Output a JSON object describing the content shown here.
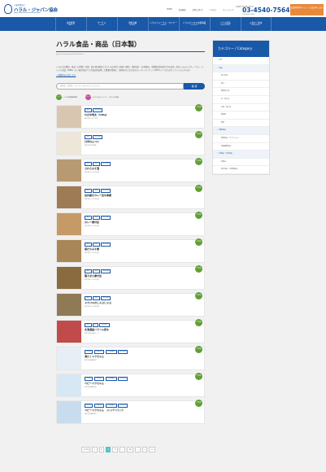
{
  "header": {
    "logo_small": "一般社団法人",
    "logo_text": "ハラル・ジャパン協会",
    "logo_en": "Japan Halal Business Association",
    "toplinks": [
      "HOME",
      "協会概要",
      "お問い合わせ",
      "アクセス",
      "サイトマップ"
    ],
    "tel_label": "お電話でのお問い合わせ",
    "tel": "03-4540-7564",
    "tel_hours": "平日 10:00〜18:00",
    "member_button": "会員様専用ページ／入会お申し込み"
  },
  "nav": [
    {
      "jp": "協会概要",
      "en": "About"
    },
    {
      "jp": "サービス",
      "en": "Service"
    },
    {
      "jp": "活動実績",
      "en": "Activity"
    },
    {
      "jp": "ハラルフォーラム・セミナー",
      "en": "Seminar"
    },
    {
      "jp": "ハラルビジネス支援事業",
      "en": "Business"
    },
    {
      "jp": "ハラル商品",
      "en": "Halal Products"
    },
    {
      "jp": "入会のご案内",
      "en": "Membership"
    }
  ],
  "page": {
    "title": "ハラル食品・商品（日本製）",
    "subtitle": "Japan International Halal Products",
    "intro": "こちらでは食品・商品（日本製）企業・個人様の販売されている日本から海外へ販売・提供会社・日本製品・企業製品等を紹介中の自社一覧のシステムです。ハラル・ジャパン協会（HJBA）の一般社団法人です認証を取得して数量や情報と、国内外のさまざまのスーパーマーケットやECサイトなどのオンラインビジネスの…",
    "intro_link": "→ 掲載申込みはこちら"
  },
  "search": {
    "placeholder": "商品名、会社名、キーワードを入力してください。",
    "button": "検 索"
  },
  "legend": [
    {
      "mark": "ハラル",
      "label": "ハラル認証取得商品",
      "color": "#5fa034"
    },
    {
      "mark": "ムスリム",
      "label": "ムスリムフレンドリー／非ハラル商品",
      "color": "#c2509a"
    }
  ],
  "products": [
    {
      "tags": [
        "食品",
        "加工食品"
      ],
      "name": "わかめ明太（130g）",
      "maker": "株式会社かね子水産",
      "badge": "ハラル",
      "thumb": "#d8c6b0"
    },
    {
      "tags": [
        "食品",
        "加工食品"
      ],
      "name": "甘学ねんべい",
      "maker": "株式会社甘学米菓",
      "badge": "ハラル",
      "thumb": "#ece7d8"
    },
    {
      "tags": [
        "食品",
        "水産",
        "加工食品"
      ],
      "name": "さわらみそ漬",
      "maker": "株式会社しまなみ水産",
      "badge": "ハラル",
      "thumb": "#b89a72"
    },
    {
      "tags": [
        "食品",
        "水産",
        "加工食品"
      ],
      "name": "信州鹿のカレー缶牛骨煮",
      "maker": "株式会社しまなみ水産",
      "badge": "ハラル",
      "thumb": "#9e7a55"
    },
    {
      "tags": [
        "食品",
        "水産",
        "加工食品"
      ],
      "name": "のレー煮付缶",
      "maker": "株式会社しまなみ水産",
      "badge": "ハラル",
      "thumb": "#c59a66"
    },
    {
      "tags": [
        "食品",
        "水産",
        "加工食品"
      ],
      "name": "真だちみそ煮",
      "maker": "株式会社しまなみ水産",
      "badge": "ハラル",
      "thumb": "#a88658"
    },
    {
      "tags": [
        "食品",
        "水産",
        "加工食品"
      ],
      "name": "鶏そぼろ煮付缶",
      "maker": "株式会社しまなみ水産",
      "badge": "ハラル",
      "thumb": "#8a6a3f"
    },
    {
      "tags": [
        "食品",
        "水産",
        "加工食品"
      ],
      "name": "メカジキのしゃぶしゃぶ",
      "maker": "株式会社しまなみ水産",
      "badge": "ハラル",
      "thumb": "#8f7a55"
    },
    {
      "tags": [
        "食品",
        "肉",
        "加工食品"
      ],
      "name": "北海道産ハラール和牛",
      "maker": "株式会社北海道ミート",
      "badge": "ハラル",
      "thumb": "#c14a4a"
    },
    {
      "tags": [
        "日用品",
        "化粧用品",
        "日用雑貨品",
        "化学用品"
      ],
      "name": "清たくマクちゃん",
      "maker": "株式会社藤田原料",
      "badge": "ハラル",
      "thumb": "#e8eef6"
    },
    {
      "tags": [
        "日用品",
        "化粧用品",
        "日用雑貨品",
        "化学用品"
      ],
      "name": "ベビーマクちゃん",
      "maker": "株式会社藤田原料",
      "badge": "ハラル",
      "thumb": "#d6e8f4"
    },
    {
      "tags": [
        "日用品",
        "化粧用品",
        "日用雑貨品",
        "化学用品"
      ],
      "name": "ベビーマクちゃん　ジッパーパック",
      "maker": "株式会社藤田原料",
      "badge": "ハラル",
      "thumb": "#c8dcee"
    }
  ],
  "pager": [
    "1 / 14",
    "«",
    "1",
    "2",
    "3",
    "…",
    "10",
    "…",
    "»",
    "»»"
  ],
  "pager_active": "2",
  "sidebar": {
    "title": "カテゴリー / Category",
    "items": [
      {
        "label": "全て",
        "kind": "top"
      },
      {
        "label": "食品",
        "kind": "group"
      },
      {
        "label": "加工食品",
        "kind": "sub"
      },
      {
        "label": "菓子",
        "kind": "sub"
      },
      {
        "label": "農産加工品",
        "kind": "sub"
      },
      {
        "label": "肉・加工品",
        "kind": "sub"
      },
      {
        "label": "水産・加工品",
        "kind": "sub"
      },
      {
        "label": "調味料",
        "kind": "sub"
      },
      {
        "label": "飲料",
        "kind": "sub"
      },
      {
        "label": "健康食品",
        "kind": "group"
      },
      {
        "label": "健康食品・サプリメント",
        "kind": "sub"
      },
      {
        "label": "栄養機能食品",
        "kind": "sub"
      },
      {
        "label": "化粧品・生活用品",
        "kind": "group"
      },
      {
        "label": "化粧品",
        "kind": "sub"
      },
      {
        "label": "衛生用品・日用雑貨品",
        "kind": "sub"
      }
    ]
  }
}
